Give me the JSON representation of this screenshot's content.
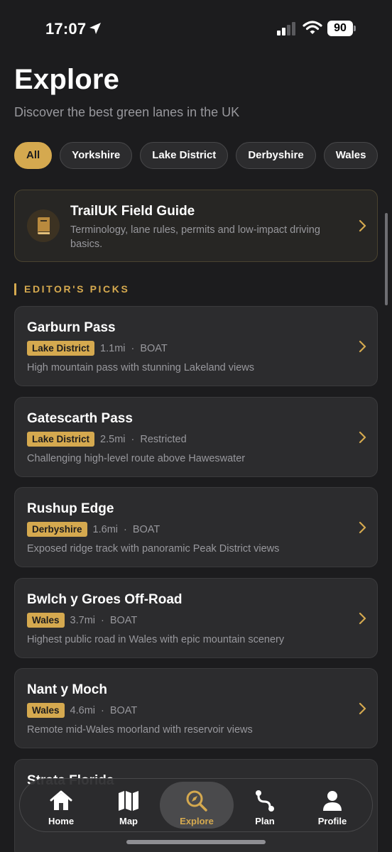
{
  "status": {
    "time": "17:07",
    "battery": "90"
  },
  "header": {
    "title": "Explore",
    "subtitle": "Discover the best green lanes in the UK"
  },
  "chips": [
    {
      "label": "All",
      "active": true
    },
    {
      "label": "Yorkshire",
      "active": false
    },
    {
      "label": "Lake District",
      "active": false
    },
    {
      "label": "Derbyshire",
      "active": false
    },
    {
      "label": "Wales",
      "active": false
    }
  ],
  "guide": {
    "title": "TrailUK Field Guide",
    "description": "Terminology, lane rules, permits and low-impact driving basics.",
    "icon": "book-icon"
  },
  "section": {
    "title": "EDITOR'S PICKS"
  },
  "routes": [
    {
      "name": "Garburn Pass",
      "region": "Lake District",
      "distance": "1.1mi",
      "type": "BOAT",
      "description": "High mountain pass with stunning Lakeland views"
    },
    {
      "name": "Gatescarth Pass",
      "region": "Lake District",
      "distance": "2.5mi",
      "type": "Restricted",
      "description": "Challenging high-level route above Haweswater"
    },
    {
      "name": "Rushup Edge",
      "region": "Derbyshire",
      "distance": "1.6mi",
      "type": "BOAT",
      "description": "Exposed ridge track with panoramic Peak District views"
    },
    {
      "name": "Bwlch y Groes Off-Road",
      "region": "Wales",
      "distance": "3.7mi",
      "type": "BOAT",
      "description": "Highest public road in Wales with epic mountain scenery"
    },
    {
      "name": "Nant y Moch",
      "region": "Wales",
      "distance": "4.6mi",
      "type": "BOAT",
      "description": "Remote mid-Wales moorland with reservoir views"
    },
    {
      "name": "Strata Florida",
      "region": "",
      "distance": "",
      "type": "",
      "description": ""
    }
  ],
  "tabs": [
    {
      "label": "Home",
      "icon": "home-icon",
      "active": false
    },
    {
      "label": "Map",
      "icon": "map-icon",
      "active": false
    },
    {
      "label": "Explore",
      "icon": "explore-icon",
      "active": true
    },
    {
      "label": "Plan",
      "icon": "route-icon",
      "active": false
    },
    {
      "label": "Profile",
      "icon": "person-icon",
      "active": false
    }
  ],
  "colors": {
    "accent": "#d5a94f",
    "background": "#1c1c1e",
    "card": "#2c2c2e",
    "muted": "#98989d"
  }
}
